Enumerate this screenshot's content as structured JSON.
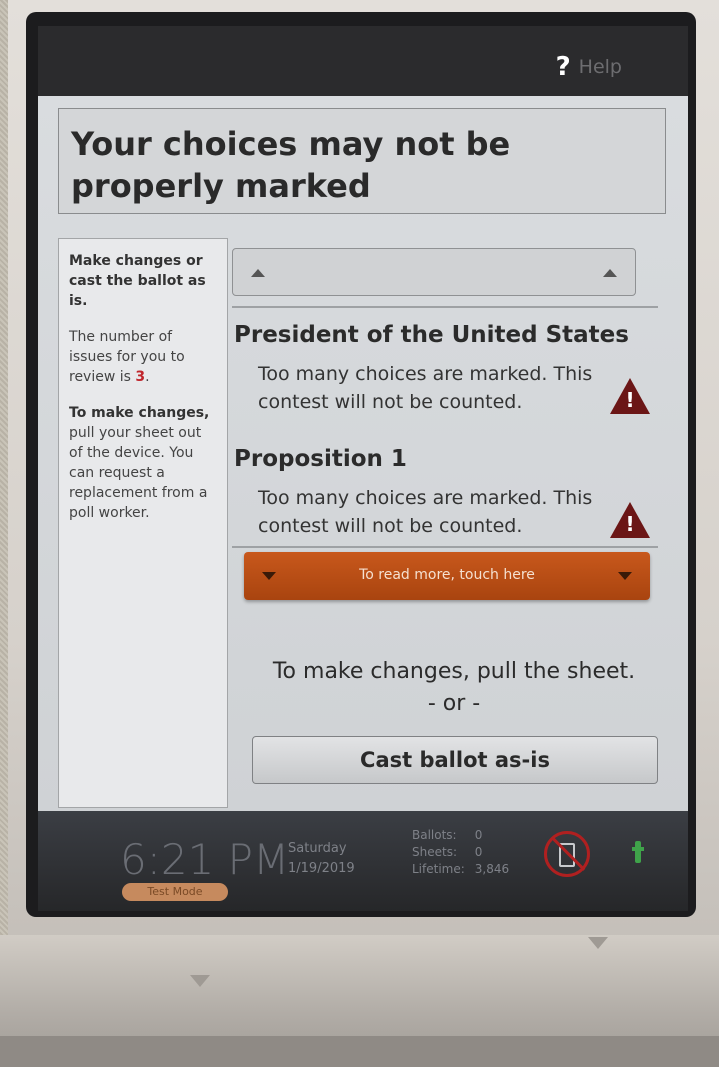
{
  "topbar": {
    "help_icon": "?",
    "help_label": "Help"
  },
  "title": "Your choices may not be properly marked",
  "sidebar": {
    "instruction_heading": "Make changes or cast the ballot as is.",
    "count_prefix": "The number of issues for you to review is ",
    "count_value": "3",
    "count_suffix": ".",
    "changes_bold": "To make changes,",
    "changes_text": " pull your sheet out of the device. You can request a replacement from a poll worker."
  },
  "contests": [
    {
      "title": "President of the United States",
      "message": "Too many choices are marked. This contest will not be counted."
    },
    {
      "title": "Proposition 1",
      "message": "Too many choices are marked. This contest will not be counted."
    }
  ],
  "read_more_label": "To read more, touch here",
  "instructions": {
    "line1": "To make changes, pull the sheet.",
    "line2": "- or -"
  },
  "cast_button_label": "Cast ballot as-is",
  "statusbar": {
    "time": "6:21 PM",
    "mode": "Test Mode",
    "day": "Saturday",
    "date": "1/19/2019",
    "ballots_label": "Ballots:",
    "ballots_value": "0",
    "sheets_label": "Sheets:",
    "sheets_value": "0",
    "lifetime_label": "Lifetime:",
    "lifetime_value": "3,846"
  },
  "colors": {
    "accent_orange": "#b8501a",
    "warning_red": "#6b1616",
    "issue_count_red": "#c0262c"
  },
  "icons": [
    "help-icon",
    "scroll-up-icon",
    "warning-icon",
    "scroll-down-icon",
    "no-device-icon",
    "power-plug-icon"
  ]
}
